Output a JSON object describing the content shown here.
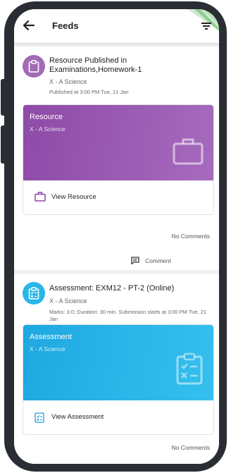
{
  "header": {
    "title": "Feeds"
  },
  "feed": [
    {
      "title": "Resource Published in Examinations,Homework-1",
      "class": "X - A Science",
      "meta": "Published at 3:00 PM Tue, 21 Jan",
      "banner": {
        "title": "Resource",
        "subtitle": "X - A Science",
        "color": "#9b59b6"
      },
      "action_label": "View Resource",
      "comments": "No Comments",
      "comment_label": "Comment"
    },
    {
      "title": "Assessment: EXM12 - PT-2 (Online)",
      "class": "X - A Science",
      "meta": "Marks: 3.0; Duration: 30 min. Submission starts at 3:00 PM Tue, 21 Jan",
      "banner": {
        "title": "Assessment",
        "subtitle": "X - A Science",
        "color": "#29b6e8"
      },
      "action_label": "View Assessment",
      "comments": "No Comments"
    }
  ],
  "colors": {
    "resource": "#9b59b6",
    "assessment": "#29b6e8"
  }
}
